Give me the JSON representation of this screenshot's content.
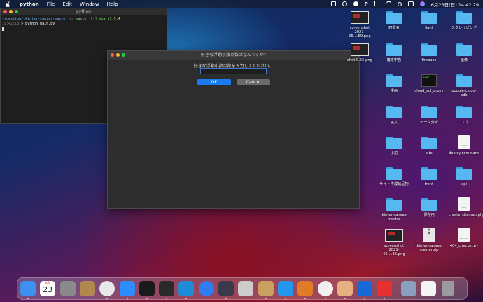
{
  "menubar": {
    "app_name": "python",
    "items": [
      "File",
      "Edit",
      "Window",
      "Help"
    ],
    "clock": "6月23日(日)  14:42:29"
  },
  "terminal": {
    "title": "python",
    "line1_path": "~/desktop/tkinter-canvas-master",
    "line1_on": " on ",
    "line1_branch": "master [!] via",
    "line1_version": "v3.9.4",
    "line2_time": "19:42:18",
    "line2_cmd": " > python main.py"
  },
  "dialog": {
    "title": "好きな浮動小数点数はなんですか?",
    "prompt": "好きな浮動小数点数を入力してください。",
    "input_value": "",
    "ok_label": "OK",
    "cancel_label": "Cancel"
  },
  "desktop_icons": [
    {
      "label": "screenshot 2021-05....59.png",
      "kind": "thumb"
    },
    {
      "label": "読書會",
      "kind": "folder"
    },
    {
      "label": "light",
      "kind": "folder"
    },
    {
      "label": "スクレイピング",
      "kind": "folder"
    },
    {
      "label": "shot 9.55.png",
      "kind": "thumb"
    },
    {
      "label": "確定申告",
      "kind": "folder"
    },
    {
      "label": "firebase",
      "kind": "folder"
    },
    {
      "label": "画像",
      "kind": "folder"
    },
    {
      "label": "漫画",
      "kind": "folder"
    },
    {
      "label": "cloud_sql_proxy",
      "kind": "exec"
    },
    {
      "label": "google-cloud-sdk",
      "kind": "folder"
    },
    {
      "label": "論文",
      "kind": "folder"
    },
    {
      "label": "データ分析",
      "kind": "folder"
    },
    {
      "label": "ロゴ",
      "kind": "folder"
    },
    {
      "label": "小説",
      "kind": "folder"
    },
    {
      "label": "site",
      "kind": "folder"
    },
    {
      "label": "deploy.command",
      "kind": "doc",
      "tag": "shell"
    },
    {
      "label": "サイト作成納品物",
      "kind": "folder"
    },
    {
      "label": "front",
      "kind": "folder"
    },
    {
      "label": "api",
      "kind": "folder"
    },
    {
      "label": "tkinter-canvas-master",
      "kind": "folder"
    },
    {
      "label": "保存用",
      "kind": "folder"
    },
    {
      "label": "create_sitemap.php",
      "kind": "doc",
      "tag": "PHP"
    },
    {
      "label": "screenshot 2021-05....35.png",
      "kind": "thumb"
    },
    {
      "label": "tkinter-canvas-master.zip",
      "kind": "zip"
    },
    {
      "label": "404_checker.py",
      "kind": "doc",
      "tag": "PYTHON"
    }
  ],
  "dock": {
    "calendar_day": "23",
    "calendar_month": "JUN",
    "apps": [
      {
        "name": "finder-icon",
        "color": "#3d8ff0"
      },
      {
        "name": "calendar-icon",
        "color": "#ffffff"
      },
      {
        "name": "system-preferences-icon",
        "color": "#8a8a8a"
      },
      {
        "name": "archive-utility-icon",
        "color": "#b08850"
      },
      {
        "name": "chrome-icon",
        "color": "#e8e8e8"
      },
      {
        "name": "zoom-icon",
        "color": "#2d8cff"
      },
      {
        "name": "iterm-icon",
        "color": "#1a1a1a"
      },
      {
        "name": "terminal-icon",
        "color": "#2a2a2a"
      },
      {
        "name": "vscode-icon",
        "color": "#1f8ad8"
      },
      {
        "name": "safari-icon",
        "color": "#2f7df0"
      },
      {
        "name": "quicktime-icon",
        "color": "#3a3a4a"
      },
      {
        "name": "sequel-pro-icon",
        "color": "#cccccc"
      },
      {
        "name": "keka-icon",
        "color": "#c8a060"
      },
      {
        "name": "docker-icon",
        "color": "#2396ed"
      },
      {
        "name": "git-client-icon",
        "color": "#e07b28"
      },
      {
        "name": "postgres-icon",
        "color": "#f0f0f0"
      },
      {
        "name": "preview-icon",
        "color": "#e6b080"
      },
      {
        "name": "infinity-app-icon",
        "color": "#1868d8"
      },
      {
        "name": "clock-icon",
        "color": "#e83030"
      },
      {
        "name": "screenshot-stack-icon",
        "color": "#8aa0c0"
      },
      {
        "name": "document-stack-icon",
        "color": "#f4f4f4"
      },
      {
        "name": "trash-icon",
        "color": "#9a9aa0"
      }
    ]
  }
}
